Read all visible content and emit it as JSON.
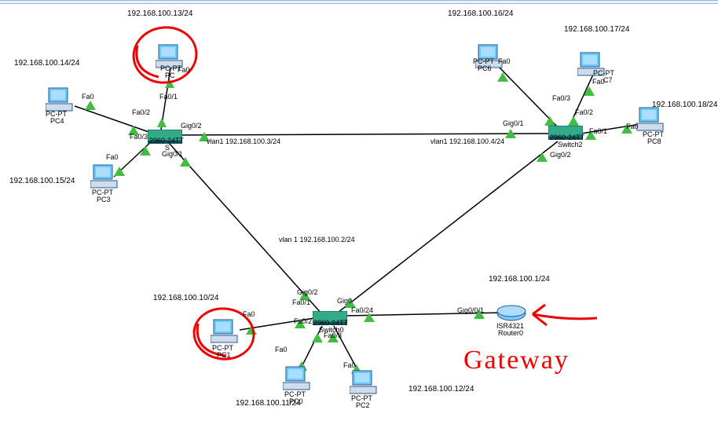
{
  "devices": {
    "pc_top_circled": {
      "type": "PC-PT",
      "name": "PC",
      "ip": "192.168.100.13/24",
      "port": "Fa0"
    },
    "pc4": {
      "type": "PC-PT",
      "name": "PC4",
      "ip": "192.168.100.14/24",
      "port": "Fa0"
    },
    "pc3": {
      "type": "PC-PT",
      "name": "PC3",
      "ip": "192.168.100.15/24",
      "port": "Fa0"
    },
    "pc6": {
      "type": "PC-PT",
      "name": "PC6",
      "ip": "192.168.100.16/24",
      "port": "Fa0"
    },
    "c7": {
      "type": "PC-PT",
      "name": "C7",
      "ip": "192.168.100.17/24",
      "port": "Fa0"
    },
    "pc8": {
      "type": "PC-PT",
      "name": "PC8",
      "ip": "192.168.100.18/24",
      "port": "Fa0"
    },
    "pc1": {
      "type": "PC-PT",
      "name": "PC1",
      "ip": "192.168.100.10/24",
      "port": "Fa0"
    },
    "pc0": {
      "type": "PC-PT",
      "name": "PC0",
      "ip": "192.168.100.11/24",
      "port": "Fa0"
    },
    "pc2": {
      "type": "PC-PT",
      "name": "PC2",
      "ip": "192.168.100.12/24",
      "port": "Fa0"
    },
    "switch_s": {
      "type": "2960-24TT",
      "name": "S",
      "vlan": "vlan1 192.168.100.3/24",
      "ports": [
        "Fa0/1",
        "Fa0/2",
        "Fa0/3",
        "Gig0/1",
        "Gig0/2"
      ]
    },
    "switch2": {
      "type": "2960-24TT",
      "name": "Switch2",
      "vlan": "vlan1 192.168.100.4/24",
      "ports": [
        "Fa0/1",
        "Fa0/2",
        "Fa0/3",
        "Gig0/1",
        "Gig0/2"
      ]
    },
    "switch0": {
      "type": "2960-24TT",
      "name": "Switch0",
      "vlan": "vlan 1 192.168.100.2/24",
      "ports": [
        "Fa0/1",
        "Fa0/2",
        "Fa0/3",
        "Fa0/24",
        "Gig0",
        "Gig0/2"
      ]
    },
    "router0": {
      "type": "ISR4321",
      "name": "Router0",
      "ip": "192.168.100.1/24",
      "port": "Gig0/0/1"
    }
  },
  "annotations": {
    "gateway_label": "Gateway"
  },
  "port_labels": {
    "fa0": "Fa0",
    "fa01": "Fa0/1",
    "fa02": "Fa0/2",
    "fa03": "Fa0/3",
    "fa024": "Fa0/24",
    "gig0": "Gig0",
    "gig01": "Gig0/1",
    "gig02": "Gig0/2",
    "gig001": "Gig0/0/1"
  }
}
